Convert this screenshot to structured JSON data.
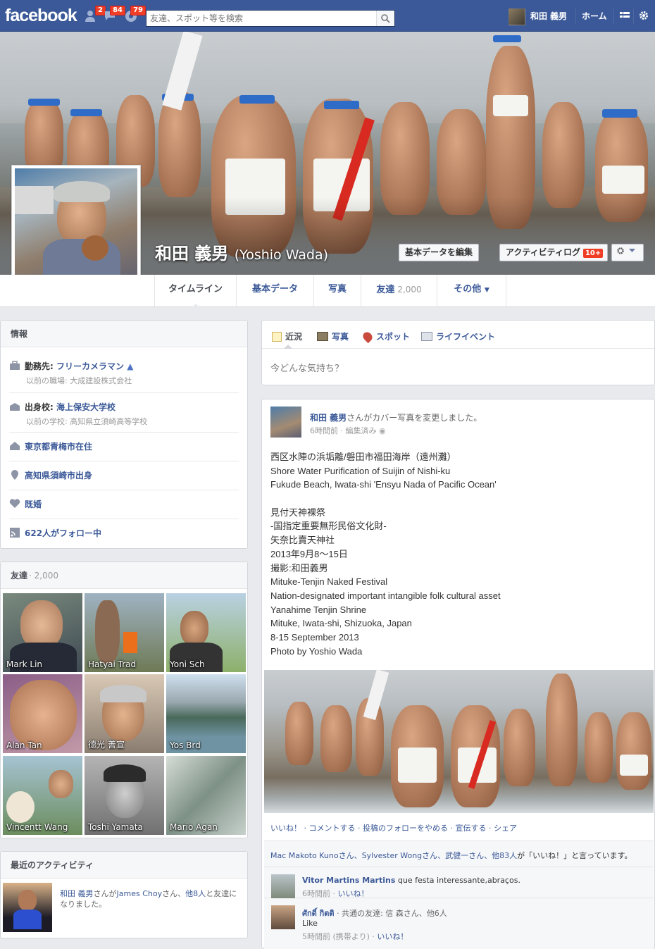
{
  "topbar": {
    "logo": "facebook",
    "friend_requests": "2",
    "messages": "84",
    "notifications": "79",
    "search_placeholder": "友達、スポット等を検索",
    "user_name": "和田 義男",
    "home": "ホーム"
  },
  "profile": {
    "name": "和田 義男",
    "name_en": "(Yoshio Wada)",
    "edit_button": "基本データを編集",
    "activity_log": "アクティビティログ",
    "activity_badge": "10+"
  },
  "tabs": [
    {
      "label": "タイムライン"
    },
    {
      "label": "基本データ"
    },
    {
      "label": "写真"
    },
    {
      "label": "友達",
      "count": "2,000"
    },
    {
      "label": "その他"
    }
  ],
  "info": {
    "title": "情報",
    "work_label": "勤務先: ",
    "work_value": "フリーカメラマン",
    "work_prev": "以前の職場: 大成建設株式会社",
    "school_label": "出身校: ",
    "school_value": "海上保安大学校",
    "school_prev": "以前の学校: 高知県立須崎高等学校",
    "lives": "東京都青梅市在住",
    "from": "高知県須崎市出身",
    "relationship": "既婚",
    "followers": "622人がフォロー中"
  },
  "friends": {
    "title": "友達",
    "count": "· 2,000",
    "list": [
      {
        "name": "Mark Lin"
      },
      {
        "name": "Hatyai Trad"
      },
      {
        "name": "Yoni Sch"
      },
      {
        "name": "Alan Tan"
      },
      {
        "name": "德光 善宣"
      },
      {
        "name": "Yos Brd"
      },
      {
        "name": "Vincentt Wang"
      },
      {
        "name": "Toshi Yamata"
      },
      {
        "name": "Mario Agan"
      }
    ]
  },
  "recent": {
    "title": "最近のアクティビティ",
    "actor": "和田 義男",
    "text1": "さんが",
    "friend": "James Choy",
    "text2": "さん、",
    "others": "他8人",
    "text3": "と友達に",
    "text4": "なりました。"
  },
  "composer": {
    "tabs": [
      "近況",
      "写真",
      "スポット",
      "ライフイベント"
    ],
    "placeholder": "今どんな気持ち？"
  },
  "post": {
    "author": "和田 義男",
    "action": "さんがカバー写真を変更しました。",
    "time": "6時間前 · 編集済み",
    "lines": [
      "西区水陣の浜垢離/磐田市福田海岸（遠州灘）",
      "Shore Water Purification of Suijin of Nishi-ku",
      "Fukude Beach, Iwata-shi 'Ensyu Nada of Pacific Ocean'",
      "",
      "見付天神裸祭",
      "-国指定重要無形民俗文化財-",
      "矢奈比賣天神社",
      "2013年9月8〜15日",
      "撮影:和田義男",
      "Mituke-Tenjin Naked Festival",
      "Nation-designated important intangible folk cultural asset",
      "Yanahime Tenjin Shrine",
      "Mituke, Iwata-shi, Shizuoka, Japan",
      "8-15 September 2013",
      "Photo by Yoshio Wada"
    ],
    "actions": "いいね！ · コメントする · 投稿のフォローをやめる · 宣伝する · シェア",
    "likes_names": "Mac Makoto Kunoさん、Sylvester Wongさん、武健一さん、他83人",
    "likes_suffix": "が「いいね！」と言っています。",
    "comments": [
      {
        "name": "Vitor Martins Martins",
        "text": " que festa interessante,abraços.",
        "meta": "6時間前 · ",
        "like": "いいね！"
      },
      {
        "name": "ศักดิ์ กิตติ",
        "text": " · 共通の友達: 信 森さん、他6人",
        "line2": "Like",
        "meta": "5時間前 (携帯より) · ",
        "like": "いいね！"
      }
    ]
  }
}
